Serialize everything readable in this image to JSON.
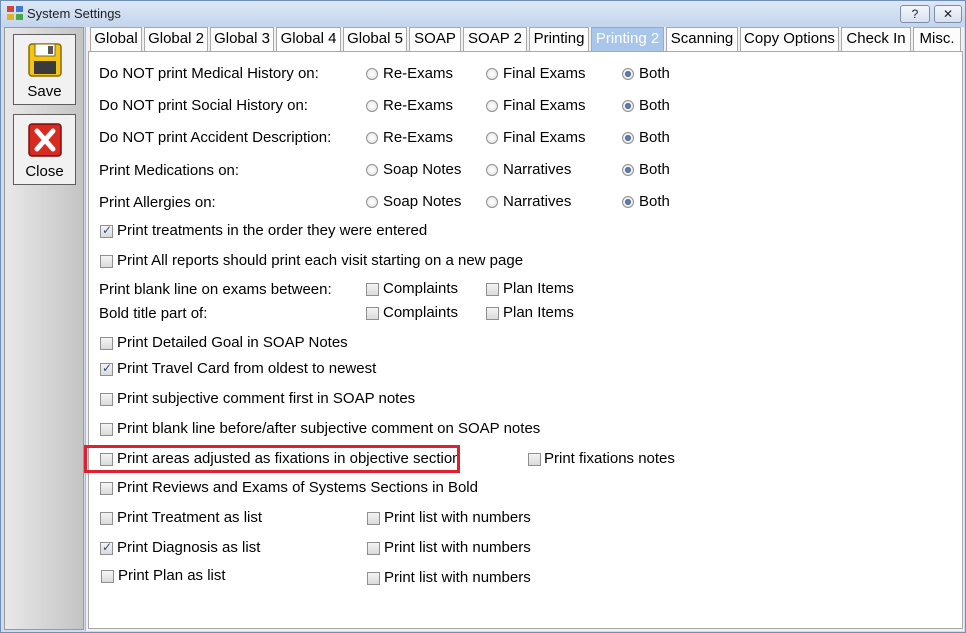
{
  "window": {
    "title": "System Settings",
    "help_label": "?",
    "close_label": "✕"
  },
  "sidebar": {
    "save_label": "Save",
    "close_label": "Close"
  },
  "tabs": [
    "Global",
    "Global 2",
    "Global 3",
    "Global 4",
    "Global 5",
    "SOAP",
    "SOAP 2",
    "Printing",
    "Printing 2",
    "Scanning",
    "Copy Options",
    "Check In",
    "Misc."
  ],
  "active_tab": "Printing 2",
  "radio_rows": [
    {
      "label": "Do NOT print Medical History on:",
      "options": [
        "Re-Exams",
        "Final Exams",
        "Both"
      ],
      "selected": "Both"
    },
    {
      "label": "Do NOT print Social History on:",
      "options": [
        "Re-Exams",
        "Final Exams",
        "Both"
      ],
      "selected": "Both"
    },
    {
      "label": "Do NOT print Accident Description:",
      "options": [
        "Re-Exams",
        "Final Exams",
        "Both"
      ],
      "selected": "Both"
    },
    {
      "label": "Print Medications on:",
      "options": [
        "Soap Notes",
        "Narratives",
        "Both"
      ],
      "selected": "Both"
    },
    {
      "label": "Print Allergies on:",
      "options": [
        "Soap Notes",
        "Narratives",
        "Both"
      ],
      "selected": "Both"
    }
  ],
  "checkboxes": {
    "treatments_order": {
      "label": "Print treatments in the order they were entered",
      "checked": true
    },
    "all_reports_new_page": {
      "label": "Print All reports should print each visit starting on a new page",
      "checked": false
    },
    "blank_line_label": "Print blank line on exams between:",
    "blank_line_complaints": {
      "label": "Complaints",
      "checked": false
    },
    "blank_line_plan": {
      "label": "Plan Items",
      "checked": false
    },
    "bold_title_label": "Bold title part of:",
    "bold_title_complaints": {
      "label": "Complaints",
      "checked": false
    },
    "bold_title_plan": {
      "label": "Plan Items",
      "checked": false
    },
    "detailed_goal": {
      "label": "Print Detailed Goal in SOAP Notes",
      "checked": false
    },
    "travel_card": {
      "label": "Print Travel Card from oldest to newest",
      "checked": true
    },
    "subjective_first": {
      "label": "Print subjective comment first in SOAP notes",
      "checked": false
    },
    "blank_before_after": {
      "label": "Print blank line before/after subjective comment on SOAP notes",
      "checked": false
    },
    "areas_fixations": {
      "label": "Print areas adjusted as fixations in objective section",
      "checked": false
    },
    "fixations_notes": {
      "label": "Print fixations notes",
      "checked": false
    },
    "reviews_bold": {
      "label": "Print Reviews and Exams of Systems Sections in Bold",
      "checked": false
    },
    "treatment_list": {
      "label": "Print Treatment as list",
      "checked": false
    },
    "treatment_numbers": {
      "label": "Print list with numbers",
      "checked": false
    },
    "diagnosis_list": {
      "label": "Print Diagnosis as list",
      "checked": true
    },
    "diagnosis_numbers": {
      "label": "Print list with numbers",
      "checked": false
    },
    "plan_list": {
      "label": "Print Plan as list",
      "checked": false
    },
    "plan_numbers": {
      "label": "Print list with numbers",
      "checked": false
    }
  },
  "colors": {
    "highlight": "#e01f2f",
    "active_tab": "#a8c6ea",
    "accent": "#2b4f85"
  }
}
